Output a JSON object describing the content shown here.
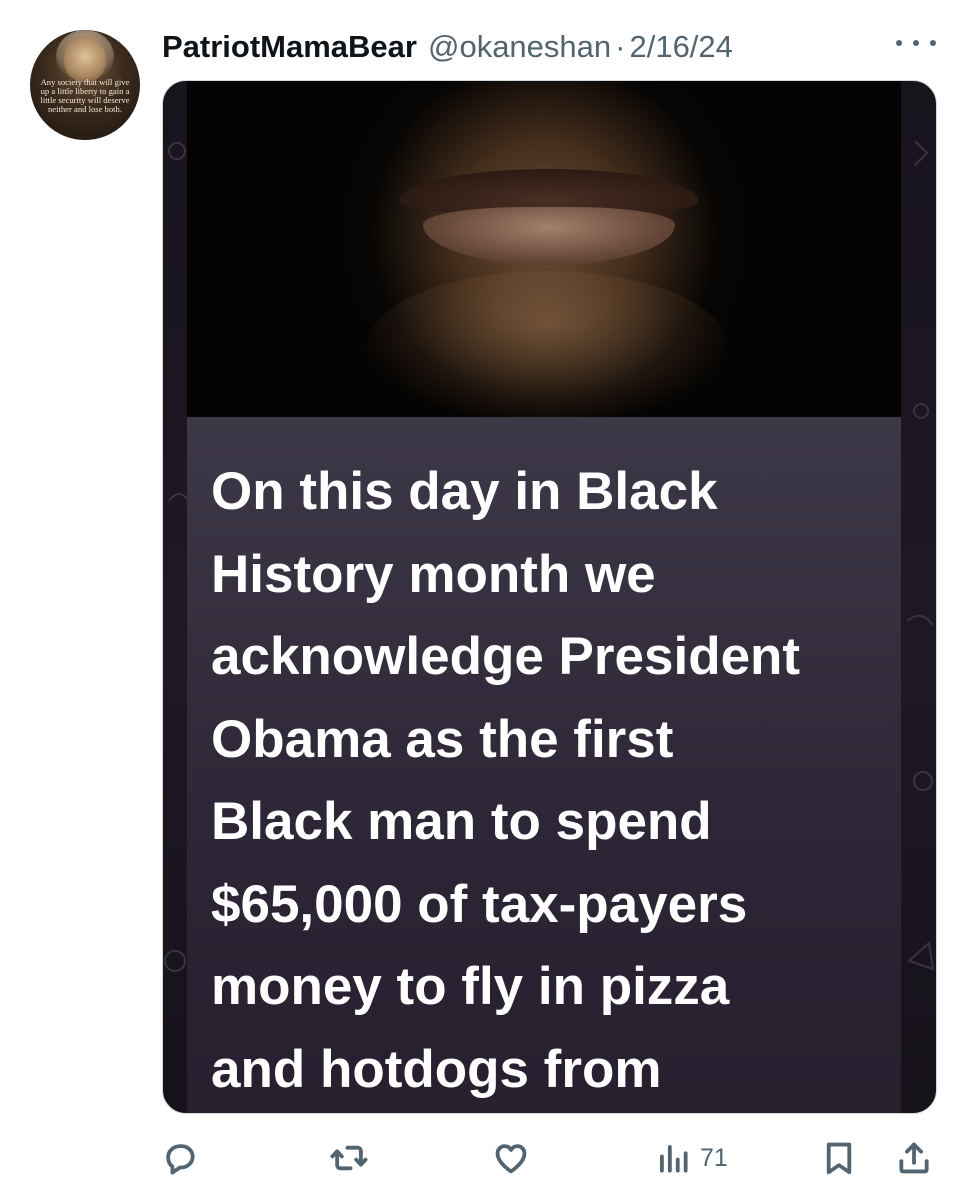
{
  "tweet": {
    "author": {
      "display_name": "PatriotMamaBear",
      "handle": "@okaneshan",
      "avatar_quote": "Any society that will give up a little liberty to gain a little security will deserve neither and lose both."
    },
    "separator": "·",
    "date": "2/16/24",
    "media": {
      "caption": "On this day in Black\nHistory month we\nacknowledge President\nObama as the first\nBlack man to spend\n$65,000 of tax-payers\nmoney to fly in pizza\nand hotdogs from"
    },
    "actions": {
      "reply_icon": "reply-icon",
      "repost_icon": "repost-icon",
      "like_icon": "heart-icon",
      "views_icon": "views-icon",
      "views_count": "71",
      "bookmark_icon": "bookmark-icon",
      "share_icon": "share-icon"
    }
  }
}
